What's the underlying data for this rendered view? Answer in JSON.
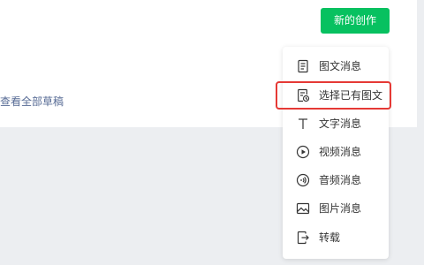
{
  "header": {
    "new_creation_label": "新的创作"
  },
  "main": {
    "view_all_drafts_label": "查看全部草稿"
  },
  "menu": {
    "items": [
      {
        "label": "图文消息",
        "icon": "document-icon"
      },
      {
        "label": "选择已有图文",
        "icon": "document-clock-icon"
      },
      {
        "label": "文字消息",
        "icon": "text-t-icon"
      },
      {
        "label": "视频消息",
        "icon": "play-circle-icon"
      },
      {
        "label": "音频消息",
        "icon": "audio-circle-icon"
      },
      {
        "label": "图片消息",
        "icon": "image-icon"
      },
      {
        "label": "转载",
        "icon": "repost-icon"
      }
    ]
  },
  "colors": {
    "primary_green": "#07c160",
    "link_blue": "#576b95",
    "highlight_red": "#e53935",
    "background": "#eceef1"
  }
}
